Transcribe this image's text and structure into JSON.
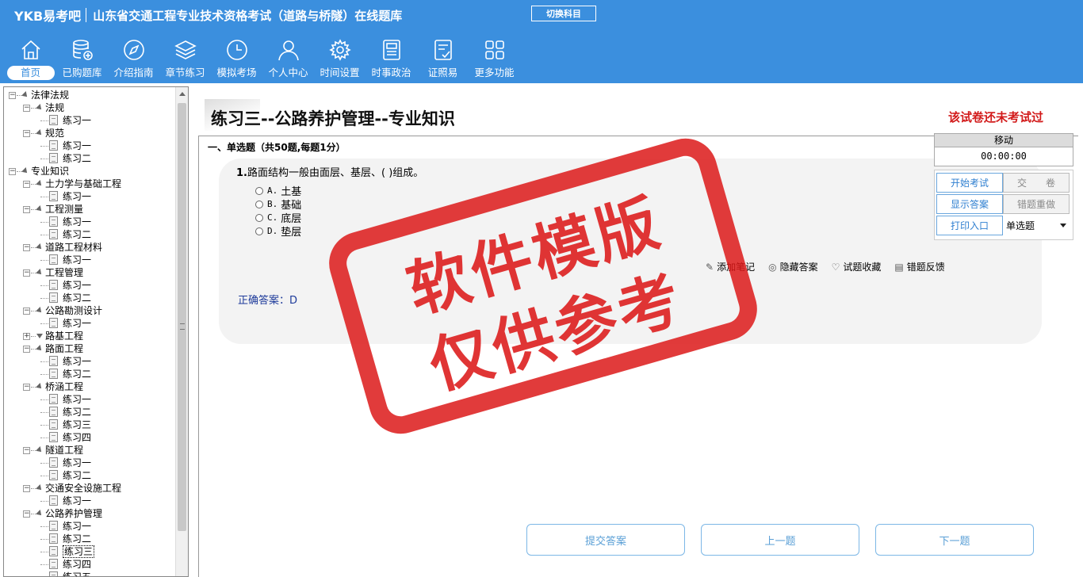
{
  "header": {
    "logo": "YKB易考吧",
    "app_title": "山东省交通工程专业技术资格考试（道路与桥隧）在线题库",
    "switch_subject": "切换科目"
  },
  "nav": [
    {
      "label": "首页",
      "icon": "home-icon"
    },
    {
      "label": "已购题库",
      "icon": "database-icon"
    },
    {
      "label": "介绍指南",
      "icon": "compass-icon"
    },
    {
      "label": "章节练习",
      "icon": "layers-icon"
    },
    {
      "label": "模拟考场",
      "icon": "clock-icon"
    },
    {
      "label": "个人中心",
      "icon": "user-icon"
    },
    {
      "label": "时间设置",
      "icon": "gear-icon"
    },
    {
      "label": "时事政治",
      "icon": "news-icon"
    },
    {
      "label": "证照易",
      "icon": "certificate-icon"
    },
    {
      "label": "更多功能",
      "icon": "grid-icon"
    }
  ],
  "tree": [
    {
      "label": "法律法规"
    },
    {
      "label": "法规"
    },
    {
      "label": "练习一"
    },
    {
      "label": "规范"
    },
    {
      "label": "练习一"
    },
    {
      "label": "练习二"
    },
    {
      "label": "专业知识"
    },
    {
      "label": "土力学与基础工程"
    },
    {
      "label": "练习一"
    },
    {
      "label": "工程测量"
    },
    {
      "label": "练习一"
    },
    {
      "label": "练习二"
    },
    {
      "label": "道路工程材料"
    },
    {
      "label": "练习一"
    },
    {
      "label": "工程管理"
    },
    {
      "label": "练习一"
    },
    {
      "label": "练习二"
    },
    {
      "label": "公路勘测设计"
    },
    {
      "label": "练习一"
    },
    {
      "label": "路基工程"
    },
    {
      "label": "路面工程"
    },
    {
      "label": "练习一"
    },
    {
      "label": "练习二"
    },
    {
      "label": "桥涵工程"
    },
    {
      "label": "练习一"
    },
    {
      "label": "练习二"
    },
    {
      "label": "练习三"
    },
    {
      "label": "练习四"
    },
    {
      "label": "隧道工程"
    },
    {
      "label": "练习一"
    },
    {
      "label": "练习二"
    },
    {
      "label": "交通安全设施工程"
    },
    {
      "label": "练习一"
    },
    {
      "label": "公路养护管理"
    },
    {
      "label": "练习一"
    },
    {
      "label": "练习二"
    },
    {
      "label": "练习三"
    },
    {
      "label": "练习四"
    },
    {
      "label": "练习五"
    }
  ],
  "exam": {
    "title": "练习三--公路养护管理--专业知识",
    "status": "该试卷还未考试过",
    "section": "一、单选题（共50题,每题1分）",
    "question_num": "1.",
    "question": "路面结构一般由面层、基层、( )组成。",
    "options": [
      {
        "key": "A.",
        "text": "土基"
      },
      {
        "key": "B.",
        "text": "基础"
      },
      {
        "key": "C.",
        "text": "底层"
      },
      {
        "key": "D.",
        "text": "垫层"
      }
    ],
    "tools": [
      "添加笔记",
      "隐藏答案",
      "试题收藏",
      "错题反馈"
    ],
    "answer": "正确答案：D"
  },
  "panel": {
    "move": "移动",
    "timer": "00:00:00",
    "start": "开始考试",
    "submit": "交　　卷",
    "show_answer": "显示答案",
    "redo_wrong": "错题重做",
    "print": "打印入口",
    "type_select": "单选题"
  },
  "bottom": {
    "submit_answer": "提交答案",
    "prev": "上一题",
    "next": "下一题"
  },
  "stamp": {
    "line1": "软件模版",
    "line2": "仅供参考"
  }
}
